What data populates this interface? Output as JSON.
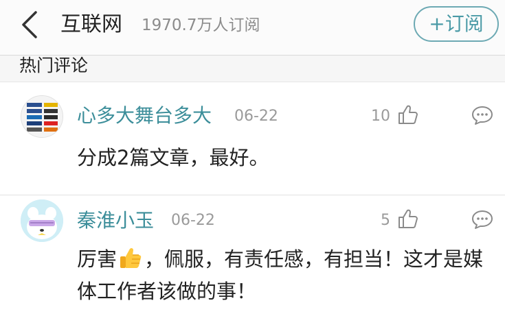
{
  "header": {
    "channel_title": "互联网",
    "subscriber_count": "1970.7万人订阅",
    "subscribe_label": "+订阅"
  },
  "section": {
    "title": "热门评论"
  },
  "comments": [
    {
      "username": "心多大舞台多大",
      "date": "06-22",
      "likes": "10",
      "text": "分成2篇文章，最好。"
    },
    {
      "username": "秦淮小玉",
      "date": "06-22",
      "likes": "5",
      "text_before_emoji": "厉害",
      "emoji": "thumbs-up-emoji",
      "text_after_emoji": "，佩服，有责任感，有担当！这才是媒体工作者该做的事！"
    }
  ],
  "colors": {
    "accent_teal": "#4a9aa6",
    "username_teal": "#3c8e9a",
    "meta_gray": "#9a9a9a"
  }
}
